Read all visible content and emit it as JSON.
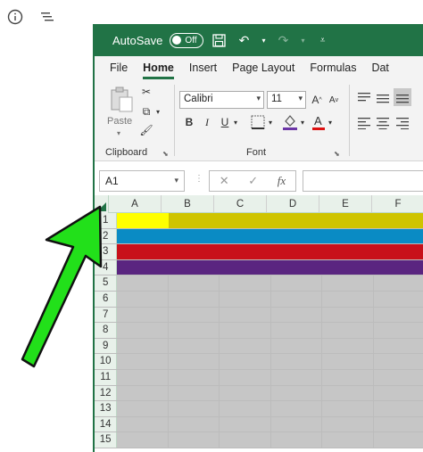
{
  "app": {
    "autosave_label": "AutoSave",
    "autosave_state": "Off"
  },
  "menu": [
    "File",
    "Home",
    "Insert",
    "Page Layout",
    "Formulas",
    "Dat"
  ],
  "ribbon": {
    "paste_label": "Paste",
    "clipboard_label": "Clipboard",
    "font_label": "Font",
    "font_name": "Calibri",
    "font_size": "11",
    "bold": "B",
    "italic": "I",
    "underline": "U"
  },
  "formula_bar": {
    "name_box": "A1",
    "fx": "fx"
  },
  "grid": {
    "columns": [
      "A",
      "B",
      "C",
      "D",
      "E",
      "F"
    ],
    "rows": [
      "1",
      "2",
      "3",
      "4",
      "5",
      "6",
      "7",
      "8",
      "9",
      "10",
      "11",
      "12",
      "13",
      "14",
      "15"
    ],
    "row_fills": {
      "1": "#cfc400",
      "2": "#0a8bc4",
      "3": "#c8101a",
      "4": "#5a2580"
    },
    "a1_fill": "#ffff00",
    "default_fill": "#c6c6c6"
  },
  "colors": {
    "accent": "#217346",
    "arrow": "#22e01a"
  }
}
